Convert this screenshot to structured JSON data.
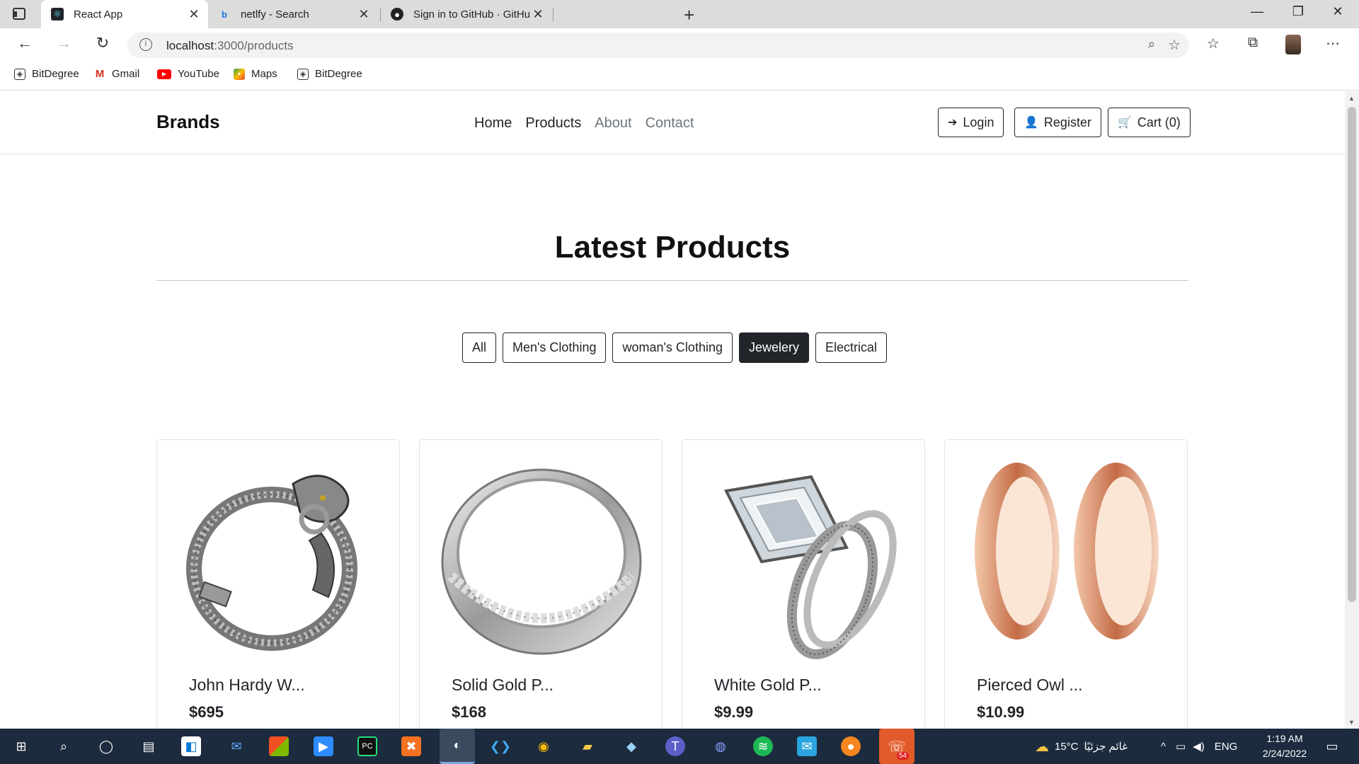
{
  "browser": {
    "tabs": [
      {
        "title": "React App",
        "icon": "react-icon"
      },
      {
        "title": "netlfy - Search",
        "icon": "bing-icon"
      },
      {
        "title": "Sign in to GitHub · GitHub",
        "icon": "github-icon"
      }
    ],
    "url_host": "localhost",
    "url_path": ":3000/products",
    "bookmarks": [
      "BitDegree",
      "Gmail",
      "YouTube",
      "Maps",
      "BitDegree"
    ]
  },
  "navbar": {
    "brand": "Brands",
    "links": [
      "Home",
      "Products",
      "About",
      "Contact"
    ],
    "login_label": "Login",
    "register_label": "Register",
    "cart_label": "Cart (0)"
  },
  "main": {
    "heading": "Latest Products",
    "filters": [
      "All",
      "Men's Clothing",
      "woman's Clothing",
      "Jewelery",
      "Electrical"
    ],
    "active_filter": "Jewelery",
    "products": [
      {
        "name": "John Hardy W...",
        "price": "$695"
      },
      {
        "name": "Solid Gold P...",
        "price": "$168"
      },
      {
        "name": "White Gold P...",
        "price": "$9.99"
      },
      {
        "name": "Pierced Owl ...",
        "price": "$10.99"
      }
    ]
  },
  "taskbar": {
    "weather": "15°C",
    "weather_text": "غائم جزئيًا",
    "language": "ENG",
    "time": "1:19 AM",
    "date": "2/24/2022",
    "whatsapp_badge": "54"
  }
}
